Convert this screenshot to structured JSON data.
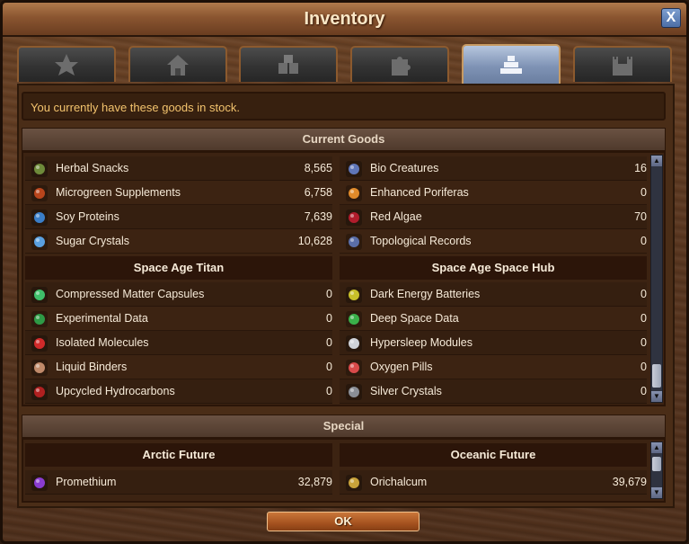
{
  "window": {
    "title": "Inventory",
    "close_label": "X"
  },
  "tabs": [
    {
      "icon": "star-icon"
    },
    {
      "icon": "house-icon"
    },
    {
      "icon": "crates-icon"
    },
    {
      "icon": "puzzle-piece-icon"
    },
    {
      "icon": "goods-stack-icon",
      "active": true
    },
    {
      "icon": "castle-icon"
    }
  ],
  "notice": "You currently have these goods in stock.",
  "current_goods": {
    "header": "Current Goods",
    "left_top": [
      {
        "name": "Herbal Snacks",
        "value": "8,565",
        "icon": "herbal-snacks-icon"
      },
      {
        "name": "Microgreen Supplements",
        "value": "6,758",
        "icon": "microgreen-supplements-icon"
      },
      {
        "name": "Soy Proteins",
        "value": "7,639",
        "icon": "soy-proteins-icon"
      },
      {
        "name": "Sugar Crystals",
        "value": "10,628",
        "icon": "sugar-crystals-icon"
      }
    ],
    "right_top": [
      {
        "name": "Bio Creatures",
        "value": "16",
        "icon": "bio-creatures-icon"
      },
      {
        "name": "Enhanced Poriferas",
        "value": "0",
        "icon": "enhanced-poriferas-icon"
      },
      {
        "name": "Red Algae",
        "value": "70",
        "icon": "red-algae-icon"
      },
      {
        "name": "Topological Records",
        "value": "0",
        "icon": "topological-records-icon"
      }
    ],
    "left_subhead": "Space Age Titan",
    "right_subhead": "Space Age Space Hub",
    "left_bottom": [
      {
        "name": "Compressed Matter Capsules",
        "value": "0",
        "icon": "compressed-matter-capsules-icon"
      },
      {
        "name": "Experimental Data",
        "value": "0",
        "icon": "experimental-data-icon"
      },
      {
        "name": "Isolated Molecules",
        "value": "0",
        "icon": "isolated-molecules-icon"
      },
      {
        "name": "Liquid Binders",
        "value": "0",
        "icon": "liquid-binders-icon"
      },
      {
        "name": "Upcycled Hydrocarbons",
        "value": "0",
        "icon": "upcycled-hydrocarbons-icon"
      }
    ],
    "right_bottom": [
      {
        "name": "Dark Energy Batteries",
        "value": "0",
        "icon": "dark-energy-batteries-icon"
      },
      {
        "name": "Deep Space Data",
        "value": "0",
        "icon": "deep-space-data-icon"
      },
      {
        "name": "Hypersleep Modules",
        "value": "0",
        "icon": "hypersleep-modules-icon"
      },
      {
        "name": "Oxygen Pills",
        "value": "0",
        "icon": "oxygen-pills-icon"
      },
      {
        "name": "Silver Crystals",
        "value": "0",
        "icon": "silver-crystals-icon"
      }
    ]
  },
  "special": {
    "header": "Special",
    "left_subhead": "Arctic Future",
    "right_subhead": "Oceanic Future",
    "left": [
      {
        "name": "Promethium",
        "value": "32,879",
        "icon": "promethium-icon"
      }
    ],
    "right": [
      {
        "name": "Orichalcum",
        "value": "39,679",
        "icon": "orichalcum-icon"
      }
    ]
  },
  "ok_label": "OK",
  "colors": {
    "notice_text": "#f3c36d",
    "active_tab": "#8fa3c4",
    "ok_button": "#b45a24"
  }
}
